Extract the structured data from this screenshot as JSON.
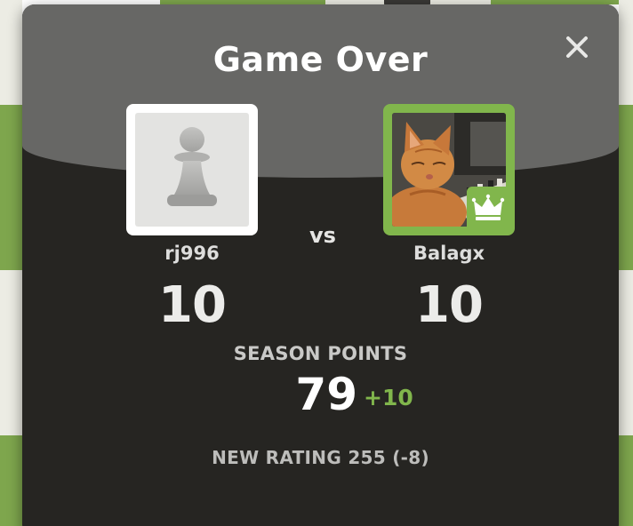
{
  "modal": {
    "title": "Game Over",
    "close_icon": "close-icon"
  },
  "players": {
    "left": {
      "username": "rj996",
      "score": "10",
      "avatar_icon": "pawn-icon"
    },
    "right": {
      "username": "Balagx",
      "score": "10",
      "avatar_icon": "cat-photo",
      "badge_icon": "crown-icon"
    }
  },
  "vs_label": "vs",
  "season": {
    "label": "SEASON POINTS",
    "value": "79",
    "delta": "+10"
  },
  "new_rating": "NEW RATING 255 (-8)",
  "colors": {
    "accent_green": "#81b64c",
    "modal_bg": "#262522",
    "header_bg": "#676765"
  }
}
